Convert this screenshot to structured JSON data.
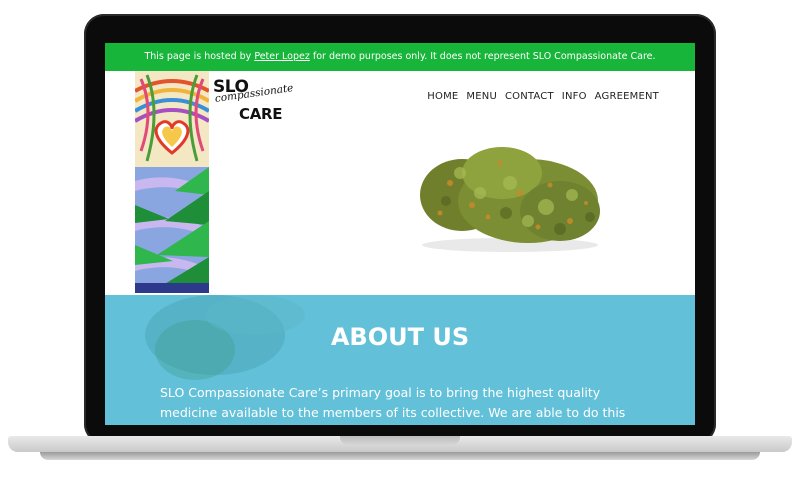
{
  "banner": {
    "prefix": "This page is hosted by ",
    "link": "Peter Lopez",
    "suffix": " for demo purposes only. It does not represent SLO Compassionate Care."
  },
  "logo": {
    "line1": "SLO",
    "line2": "compassionate",
    "line3": "CARE"
  },
  "nav": [
    "HOME",
    "MENU",
    "CONTACT",
    "INFO",
    "AGREEMENT"
  ],
  "about": {
    "title": "ABOUT US",
    "text": "SLO Compassionate Care’s primary goal is to bring the highest quality medicine available to the members of its collective. We are able to do this through our direct"
  },
  "colors": {
    "banner": "#17b53a",
    "about_bg": "#62c1d8"
  }
}
